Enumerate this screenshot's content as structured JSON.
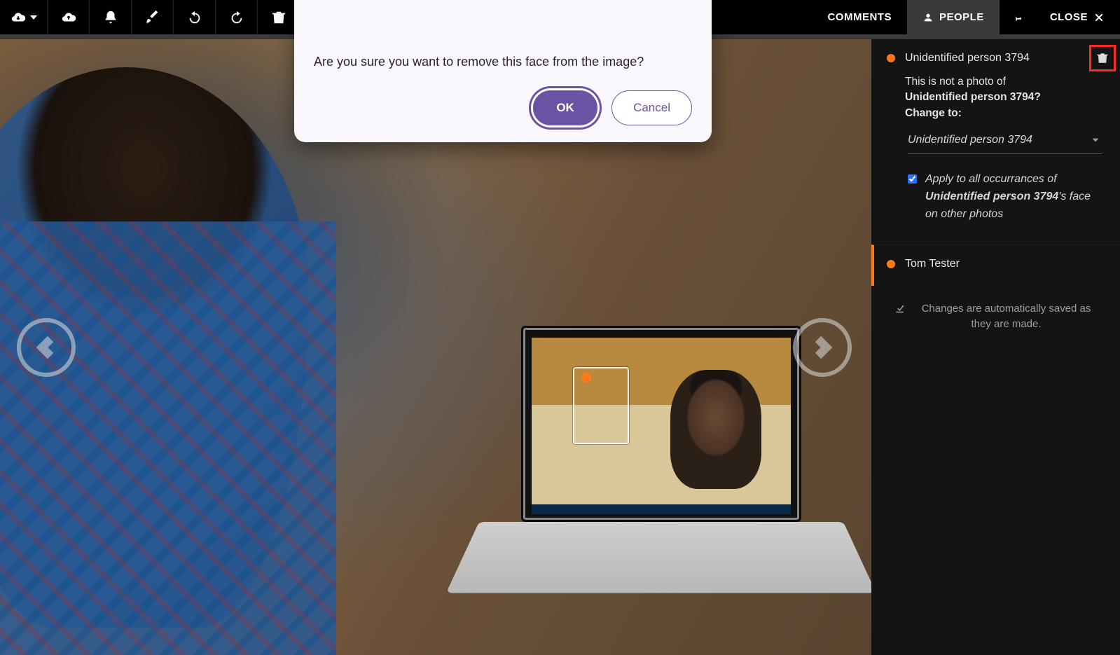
{
  "colors": {
    "accent": "#ff7a1a",
    "primary": "#6b53a3",
    "highlight": "#ff2a2a"
  },
  "toolbar": {
    "tabs": {
      "comments": "COMMENTS",
      "people": "PEOPLE",
      "close": "CLOSE"
    }
  },
  "modal": {
    "message": "Are you sure you want to remove this face from the image?",
    "ok": "OK",
    "cancel": "Cancel"
  },
  "panel": {
    "person1": {
      "name": "Unidentified person 3794",
      "not_photo_line1": "This is not a photo of",
      "not_photo_name": "Unidentified person 3794",
      "not_photo_q": "?",
      "change_to": "Change to:",
      "dropdown_value": "Unidentified person 3794",
      "apply_pre": "Apply to all occurrances of ",
      "apply_name": "Unidentified person 3794",
      "apply_post": "'s face on other photos"
    },
    "person2": {
      "name": "Tom Tester"
    },
    "autosave": "Changes are automatically saved as they are made."
  }
}
